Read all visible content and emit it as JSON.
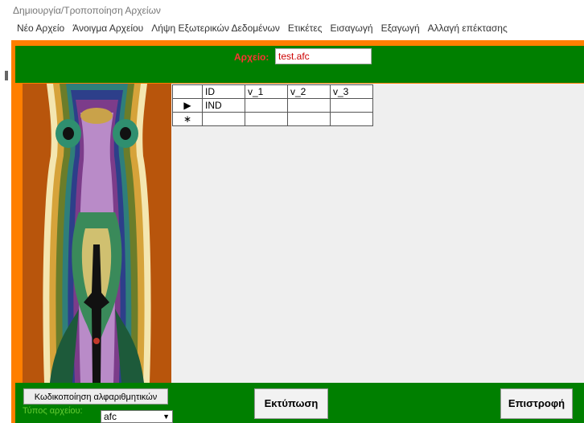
{
  "window": {
    "title": "Δημιουργία/Τροποποίηση Αρχείων"
  },
  "menu": [
    "Νέο Αρχείο",
    "Άνοιγμα Αρχείου",
    "Λήψη Εξωτερικών Δεδομένων",
    "Ετικέτες",
    "Εισαγωγή",
    "Εξαγωγή",
    "Αλλαγή επέκτασης"
  ],
  "file": {
    "label": "Αρχείο:",
    "value": "test.afc"
  },
  "grid": {
    "columns": [
      "ID",
      "v_1",
      "v_2",
      "v_3"
    ],
    "rows": [
      [
        "IND",
        "",
        "",
        ""
      ]
    ],
    "current_marker": "▶",
    "new_marker": "∗"
  },
  "buttons": {
    "encode": "Κωδικοποίηση αλφαριθμητικών",
    "print": "Εκτύπωση",
    "back": "Επιστροφή"
  },
  "file_type": {
    "label": "Τύπος αρχείου:",
    "value": "afc"
  },
  "colors": {
    "frame": "#ff7f00",
    "panel": "#007f00",
    "grid_bg": "#efefef"
  }
}
